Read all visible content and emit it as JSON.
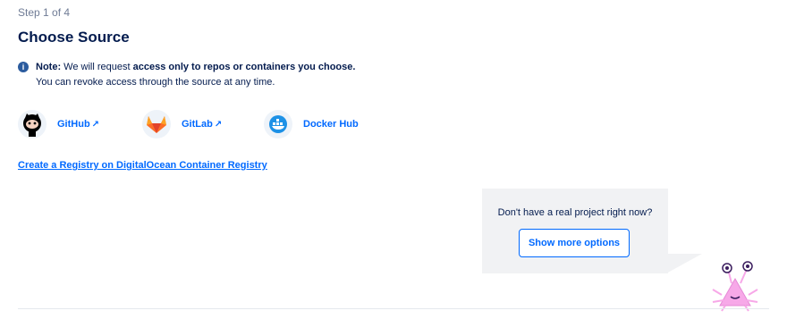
{
  "header": {
    "step": "Step 1 of 4",
    "title": "Choose Source"
  },
  "note": {
    "label": "Note:",
    "text_before": "We will request",
    "text_bold": "access only to repos or containers you choose.",
    "line2": "You can revoke access through the source at any time."
  },
  "providers": [
    {
      "label": "GitHub",
      "external": "↗",
      "icon": "github-icon"
    },
    {
      "label": "GitLab",
      "external": "↗",
      "icon": "gitlab-icon"
    },
    {
      "label": "Docker Hub",
      "external": "",
      "icon": "docker-icon"
    }
  ],
  "registry_link": "Create a Registry on DigitalOcean Container Registry",
  "callout": {
    "text": "Don't have a real project right now?",
    "button": "Show more options"
  },
  "colors": {
    "link": "#0069ff",
    "text": "#031b4e",
    "muted": "#6f7b95",
    "callout_bg": "#f1f2f4",
    "mascot": "#f7a8e8"
  }
}
